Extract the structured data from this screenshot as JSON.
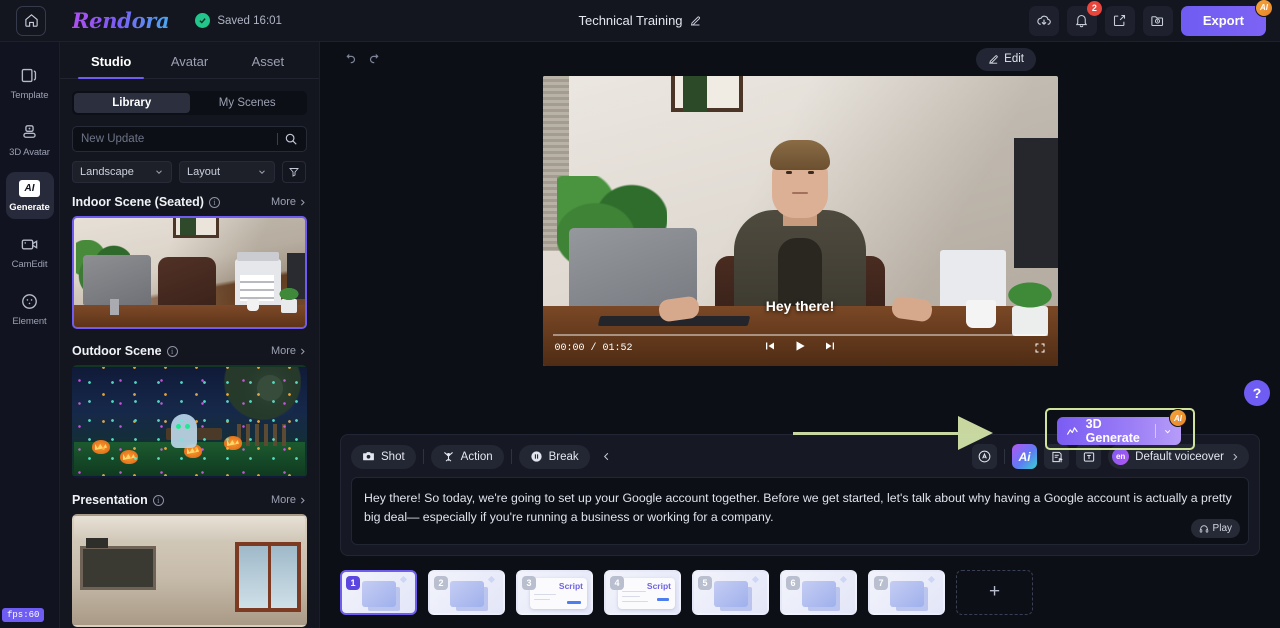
{
  "topbar": {
    "home_icon": "home-icon",
    "brand": "Rendora",
    "saved_label": "Saved 16:01",
    "doc_title": "Technical Training",
    "edit_title_icon": "pencil-icon",
    "actions": [
      {
        "name": "download-icon",
        "glyph": "cloud-download"
      },
      {
        "name": "notifications-icon",
        "glyph": "bell",
        "badge": "2"
      },
      {
        "name": "share-icon",
        "glyph": "share"
      },
      {
        "name": "history-icon",
        "glyph": "folder-clock"
      }
    ],
    "export_label": "Export",
    "export_badge": "AI"
  },
  "rail": {
    "items": [
      {
        "label": "Template",
        "icon": "template-icon",
        "active": false
      },
      {
        "label": "3D Avatar",
        "icon": "avatar-icon",
        "active": false
      },
      {
        "label": "Generate",
        "icon": "ai-generate-icon",
        "active": true
      },
      {
        "label": "CamEdit",
        "icon": "camera-edit-icon",
        "active": false
      },
      {
        "label": "Element",
        "icon": "element-icon",
        "active": false
      }
    ],
    "fps_badge": "fps:60"
  },
  "panel": {
    "tabs": [
      {
        "label": "Studio",
        "active": true
      },
      {
        "label": "Avatar",
        "active": false
      },
      {
        "label": "Asset",
        "active": false
      }
    ],
    "segments": [
      {
        "label": "Library",
        "active": true
      },
      {
        "label": "My Scenes",
        "active": false
      }
    ],
    "search": {
      "placeholder": "New Update",
      "value": "",
      "icon": "search-icon"
    },
    "filters": {
      "orientation": "Landscape",
      "layout": "Layout",
      "filter_icon": "funnel-icon"
    },
    "sections": [
      {
        "title": "Indoor Scene (Seated)",
        "more": "More",
        "selected": true,
        "art": "indoor"
      },
      {
        "title": "Outdoor Scene",
        "more": "More",
        "selected": false,
        "art": "outdoor"
      },
      {
        "title": "Presentation",
        "more": "More",
        "selected": false,
        "art": "present"
      }
    ]
  },
  "main": {
    "undo_icon": "undo-icon",
    "redo_icon": "redo-icon",
    "edit_button": "Edit",
    "player": {
      "caption": "Hey there!",
      "current_time": "00:00",
      "total_time": "01:52",
      "time_display": "00:00 / 01:52",
      "prev_icon": "skip-previous-icon",
      "play_icon": "play-icon",
      "next_icon": "skip-next-icon",
      "fullscreen_icon": "fullscreen-icon"
    },
    "generate_button": {
      "label": "3D Generate",
      "icon": "trend-line-icon",
      "dropdown_icon": "chevron-down-icon",
      "badge": "AI",
      "highlight_color": "#cfe49a"
    },
    "help_button": "?"
  },
  "script": {
    "tools": [
      {
        "label": "Shot",
        "icon": "camera-icon"
      },
      {
        "label": "Action",
        "icon": "action-person-icon"
      },
      {
        "label": "Break",
        "icon": "pause-icon"
      }
    ],
    "collapse_icon": "chevron-left-icon",
    "right_tools": [
      {
        "name": "magic-wand-icon",
        "glyph": "A"
      },
      {
        "name": "ai-assistant-icon",
        "glyph": "Ai"
      },
      {
        "name": "script-import-icon",
        "glyph": "doc"
      },
      {
        "name": "text-box-icon",
        "glyph": "T"
      }
    ],
    "voiceover": {
      "lang": "en",
      "label": "Default voiceover",
      "chevron": "chevron-right-icon"
    },
    "text": "Hey there! So today, we're going to set up your Google account together. Before we get started, let's talk about why having a Google account is actually a pretty big deal— especially if you're running a business or working for a company.",
    "play_label": "Play",
    "play_icon": "headphones-icon"
  },
  "timeline": {
    "scenes": [
      {
        "num": "1",
        "type": "image",
        "selected": true
      },
      {
        "num": "2",
        "type": "image",
        "selected": false
      },
      {
        "num": "3",
        "type": "script",
        "label": "Script",
        "selected": false
      },
      {
        "num": "4",
        "type": "script",
        "label": "Script",
        "selected": false
      },
      {
        "num": "5",
        "type": "image",
        "selected": false
      },
      {
        "num": "6",
        "type": "image",
        "selected": false
      },
      {
        "num": "7",
        "type": "image",
        "selected": false
      }
    ],
    "add_label": "+"
  },
  "colors": {
    "accent": "#6f5cf2",
    "bg": "#0d0f16",
    "panel": "#14161f",
    "annotation_green": "#cfe49a",
    "badge_red": "#e8453c",
    "saved_green": "#22c58b"
  }
}
